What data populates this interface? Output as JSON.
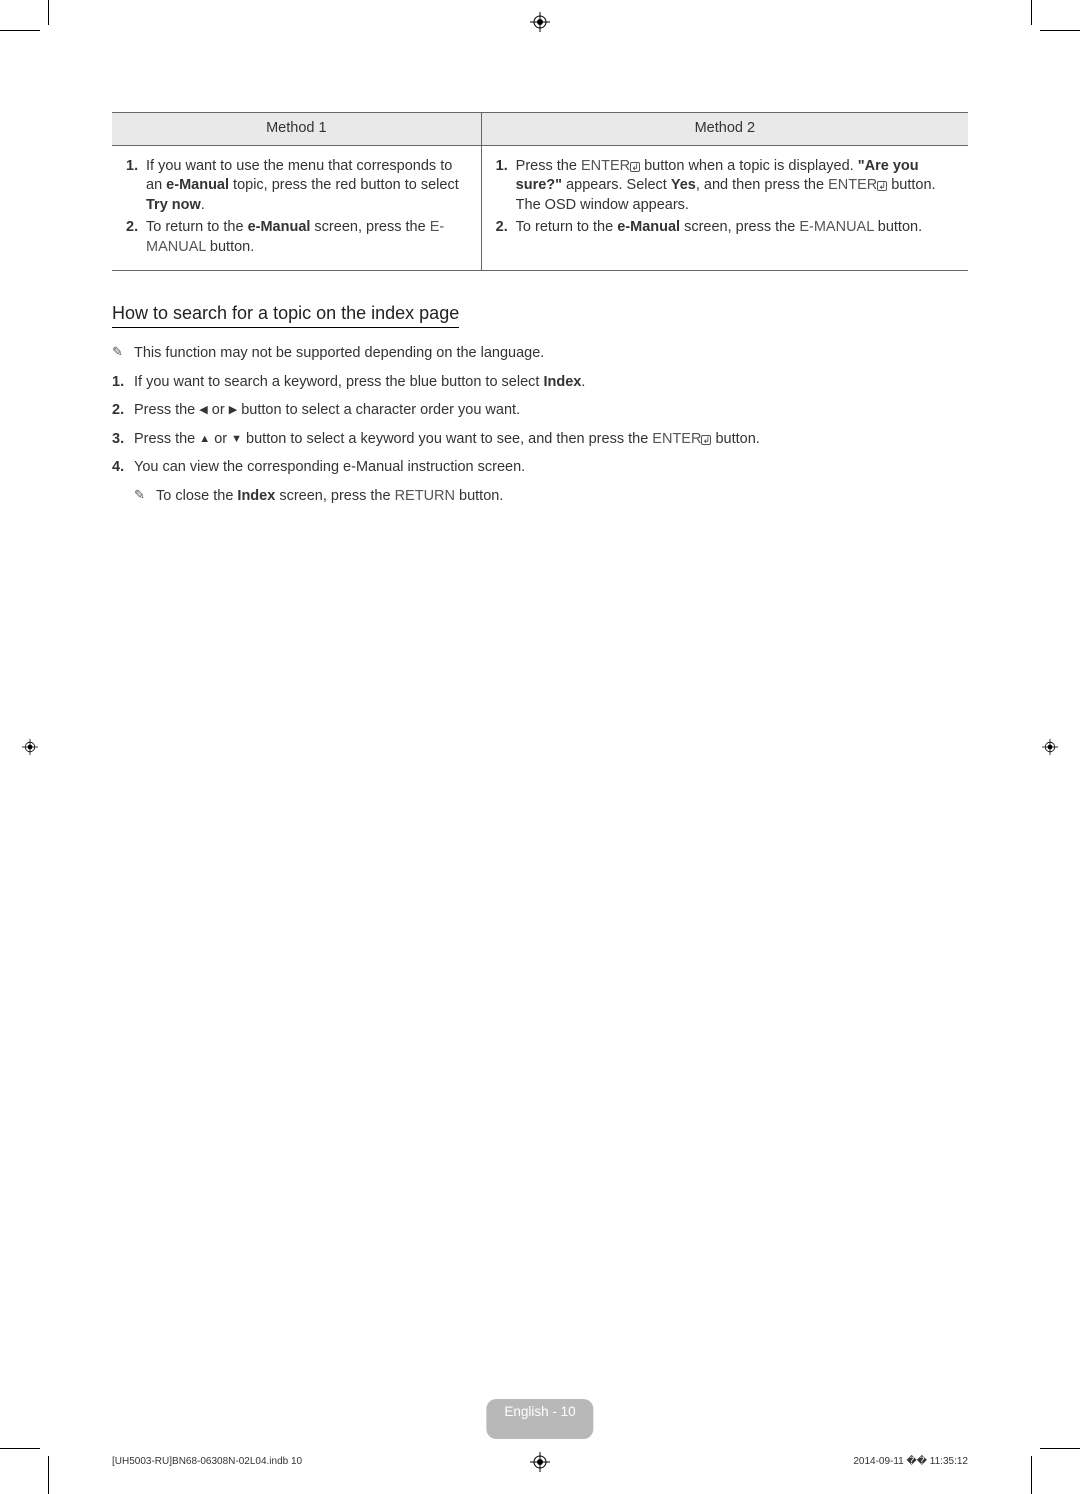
{
  "table": {
    "headers": [
      "Method 1",
      "Method 2"
    ],
    "col1": {
      "step1_num": "1.",
      "step1_a": "If you want to use the menu that corresponds to an ",
      "step1_b": "e-Manual",
      "step1_c": " topic, press the red button to select ",
      "step1_d": "Try now",
      "step1_e": ".",
      "step2_num": "2.",
      "step2_a": "To return to the ",
      "step2_b": "e-Manual",
      "step2_c": " screen, press the ",
      "step2_d": "E-MANUAL",
      "step2_e": " button."
    },
    "col2": {
      "step1_num": "1.",
      "step1_a": "Press the ",
      "step1_b": "ENTER",
      "step1_c": " button when a topic is displayed. ",
      "step1_d": "\"Are you sure?\"",
      "step1_e": " appears. Select ",
      "step1_f": "Yes",
      "step1_g": ", and then press the ",
      "step1_h": "ENTER",
      "step1_i": " button. The OSD window appears.",
      "step2_num": "2.",
      "step2_a": "To return to the ",
      "step2_b": "e-Manual",
      "step2_c": " screen, press the ",
      "step2_d": "E-MANUAL",
      "step2_e": " button."
    }
  },
  "heading": "How to search for a topic on the index page",
  "list": {
    "note1": "This function may not be supported depending on the language.",
    "s1_num": "1.",
    "s1_a": "If you want to search a keyword, press the blue button to select ",
    "s1_b": "Index",
    "s1_c": ".",
    "s2_num": "2.",
    "s2_a": "Press the ",
    "s2_b": " or ",
    "s2_c": " button to select a character order you want.",
    "s3_num": "3.",
    "s3_a": "Press the ",
    "s3_b": " or ",
    "s3_c": " button to select a keyword you want to see, and then press the ",
    "s3_d": "ENTER",
    "s3_e": " button.",
    "s4_num": "4.",
    "s4_a": "You can view the corresponding e-Manual instruction screen.",
    "subnote_a": "To close the ",
    "subnote_b": "Index",
    "subnote_c": " screen, press the ",
    "subnote_d": "RETURN",
    "subnote_e": " button."
  },
  "footer": {
    "badge": "English - 10",
    "left": "[UH5003-RU]BN68-06308N-02L04.indb   10",
    "right": "2014-09-11   �� 11:35:12"
  },
  "glyphs": {
    "note": "✎",
    "left": "◀",
    "right": "▶",
    "up": "▲",
    "down": "▼"
  }
}
